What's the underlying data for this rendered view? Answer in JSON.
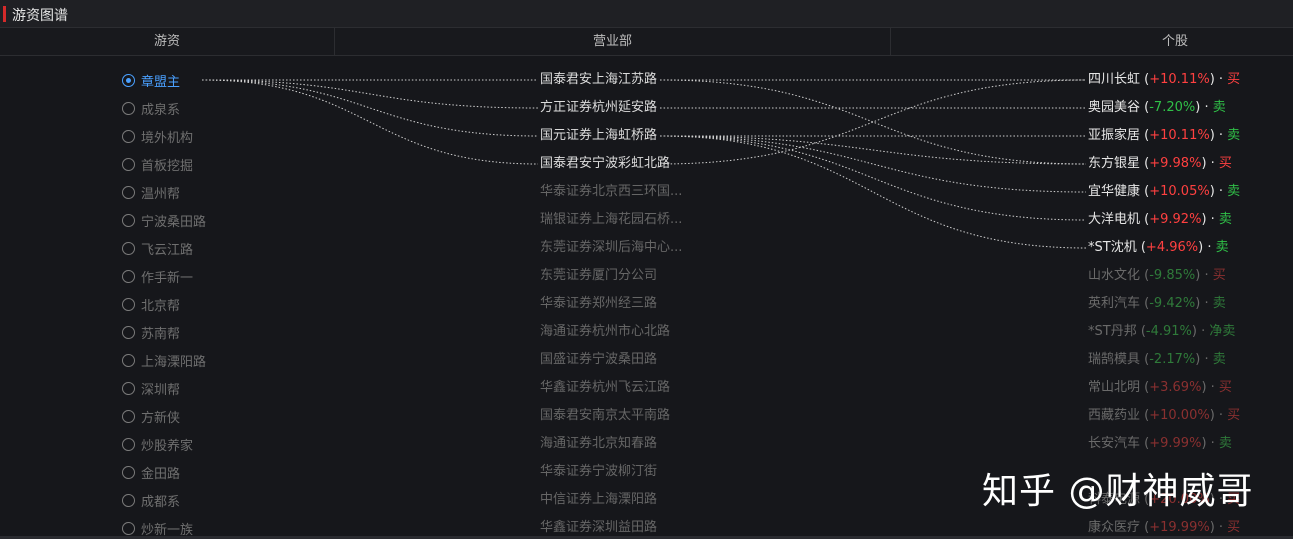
{
  "title": "游资图谱",
  "columns": {
    "youzi": "游资",
    "yingyebu": "营业部",
    "gegu": "个股"
  },
  "youzi": [
    {
      "label": "章盟主",
      "selected": true
    },
    {
      "label": "成泉系"
    },
    {
      "label": "境外机构"
    },
    {
      "label": "首板挖掘"
    },
    {
      "label": "温州帮"
    },
    {
      "label": "宁波桑田路"
    },
    {
      "label": "飞云江路"
    },
    {
      "label": "作手新一"
    },
    {
      "label": "北京帮"
    },
    {
      "label": "苏南帮"
    },
    {
      "label": "上海溧阳路"
    },
    {
      "label": "深圳帮"
    },
    {
      "label": "方新侠"
    },
    {
      "label": "炒股养家"
    },
    {
      "label": "金田路"
    },
    {
      "label": "成都系"
    },
    {
      "label": "炒新一族"
    }
  ],
  "yingyebu": [
    {
      "label": "国泰君安上海江苏路",
      "active": true
    },
    {
      "label": "方正证券杭州延安路",
      "active": true
    },
    {
      "label": "国元证券上海虹桥路",
      "active": true
    },
    {
      "label": "国泰君安宁波彩虹北路",
      "active": true
    },
    {
      "label": "华泰证券北京西三环国..."
    },
    {
      "label": "瑞银证券上海花园石桥..."
    },
    {
      "label": "东莞证券深圳后海中心..."
    },
    {
      "label": "东莞证券厦门分公司"
    },
    {
      "label": "华泰证券郑州经三路"
    },
    {
      "label": "海通证券杭州市心北路"
    },
    {
      "label": "国盛证券宁波桑田路"
    },
    {
      "label": "华鑫证券杭州飞云江路"
    },
    {
      "label": "国泰君安南京太平南路"
    },
    {
      "label": "海通证券北京知春路"
    },
    {
      "label": "华泰证券宁波柳汀街"
    },
    {
      "label": "中信证券上海溧阳路"
    },
    {
      "label": "华鑫证券深圳益田路"
    }
  ],
  "gegu": [
    {
      "name": "四川长虹",
      "change": "+10.11%",
      "dir": "up",
      "action": "买",
      "actType": "buy",
      "active": true
    },
    {
      "name": "奥园美谷",
      "change": "-7.20%",
      "dir": "down",
      "action": "卖",
      "actType": "sell",
      "active": true
    },
    {
      "name": "亚振家居",
      "change": "+10.11%",
      "dir": "up",
      "action": "卖",
      "actType": "sell",
      "active": true
    },
    {
      "name": "东方银星",
      "change": "+9.98%",
      "dir": "up",
      "action": "买",
      "actType": "buy",
      "active": true
    },
    {
      "name": "宜华健康",
      "change": "+10.05%",
      "dir": "up",
      "action": "卖",
      "actType": "sell",
      "active": true
    },
    {
      "name": "大洋电机",
      "change": "+9.92%",
      "dir": "up",
      "action": "卖",
      "actType": "sell",
      "active": true
    },
    {
      "name": "*ST沈机",
      "change": "+4.96%",
      "dir": "up",
      "action": "卖",
      "actType": "sell",
      "active": true
    },
    {
      "name": "山水文化",
      "change": "-9.85%",
      "dir": "down",
      "action": "买",
      "actType": "buy"
    },
    {
      "name": "英利汽车",
      "change": "-9.42%",
      "dir": "down",
      "action": "卖",
      "actType": "sell"
    },
    {
      "name": "*ST丹邦",
      "change": "-4.91%",
      "dir": "down",
      "action": "净卖",
      "actType": "sell"
    },
    {
      "name": "瑞鹄模具",
      "change": "-2.17%",
      "dir": "down",
      "action": "卖",
      "actType": "sell"
    },
    {
      "name": "常山北明",
      "change": "+3.69%",
      "dir": "up",
      "action": "买",
      "actType": "buy"
    },
    {
      "name": "西藏药业",
      "change": "+10.00%",
      "dir": "up",
      "action": "买",
      "actType": "buy"
    },
    {
      "name": "长安汽车",
      "change": "+9.99%",
      "dir": "up",
      "action": "卖",
      "actType": "sell"
    },
    {
      "name": "",
      "change": "",
      "dir": "up",
      "action": "",
      "actType": "buy"
    },
    {
      "name": "科泰电源",
      "change": "+20.00%",
      "dir": "up",
      "action": "买",
      "actType": "buy"
    },
    {
      "name": "康众医疗",
      "change": "+19.99%",
      "dir": "up",
      "action": "买",
      "actType": "buy"
    }
  ],
  "links_youzi_to_yyb": [
    [
      0,
      0
    ],
    [
      0,
      1
    ],
    [
      0,
      2
    ],
    [
      0,
      3
    ]
  ],
  "links_yyb_to_gegu": [
    [
      0,
      0
    ],
    [
      0,
      3
    ],
    [
      1,
      1
    ],
    [
      2,
      2
    ],
    [
      2,
      3
    ],
    [
      2,
      4
    ],
    [
      2,
      5
    ],
    [
      2,
      6
    ],
    [
      3,
      0
    ]
  ],
  "watermark": "知乎 @财神威哥"
}
